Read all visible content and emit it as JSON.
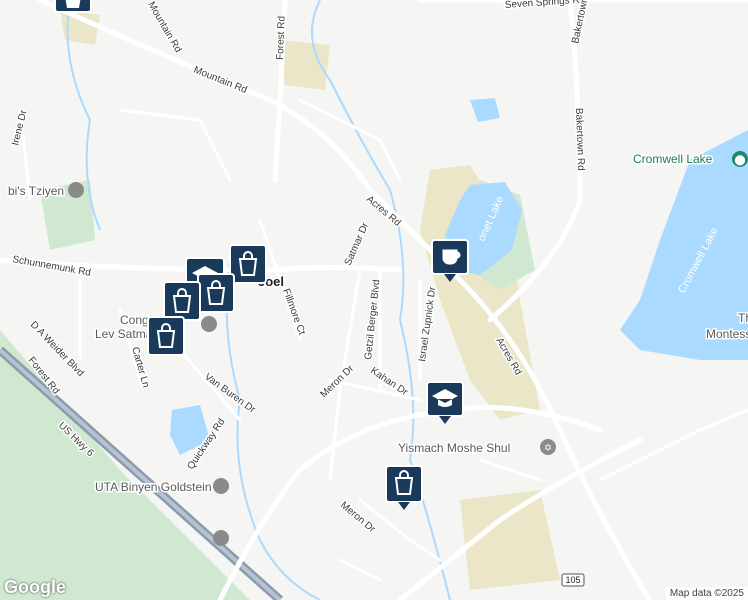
{
  "map": {
    "logo": "Google",
    "attribution": "Map data ©2025",
    "place": "Joel",
    "colors": {
      "background": "#f5f5f3",
      "water": "#aadaff",
      "green": "#c8e6c9",
      "sand": "#ece6c8",
      "highway": "#8a9bb0",
      "road": "#ffffff",
      "marker": "#1a3a5c"
    },
    "roads": [
      {
        "id": "seven-springs-rd",
        "label": "Seven Springs Rd"
      },
      {
        "id": "mountain-rd-top",
        "label": "Mountain Rd"
      },
      {
        "id": "mountain-rd",
        "label": "Mountain Rd"
      },
      {
        "id": "forest-rd-top",
        "label": "Forest Rd"
      },
      {
        "id": "bakertown-rd-top",
        "label": "Bakertown Rd"
      },
      {
        "id": "bakertown-rd",
        "label": "Bakertown Rd"
      },
      {
        "id": "irene-dr",
        "label": "Irene Dr"
      },
      {
        "id": "acres-rd",
        "label": "Acres Rd"
      },
      {
        "id": "acres-rd-south",
        "label": "Acres Rd"
      },
      {
        "id": "satmar-dr",
        "label": "Satmar Dr"
      },
      {
        "id": "schunnemunk-rd",
        "label": "Schunnemunk Rd"
      },
      {
        "id": "fillmore-ct",
        "label": "Fillmore Ct"
      },
      {
        "id": "getzil-berger-blvd",
        "label": "Getzil Berger Blvd"
      },
      {
        "id": "israel-zupnick-dr",
        "label": "Israel Zupnick Dr"
      },
      {
        "id": "d-a-weider-blvd",
        "label": "D A Weider Blvd"
      },
      {
        "id": "forest-rd",
        "label": "Forest Rd"
      },
      {
        "id": "carter-ln",
        "label": "Carter Ln"
      },
      {
        "id": "van-buren-dr",
        "label": "Van Buren Dr"
      },
      {
        "id": "meron-dr",
        "label": "Meron Dr"
      },
      {
        "id": "kahan-dr",
        "label": "Kahan Dr"
      },
      {
        "id": "quickway-rd",
        "label": "Quickway Rd"
      },
      {
        "id": "us-hwy-6",
        "label": "US Hwy 6"
      },
      {
        "id": "meron-dr-south",
        "label": "Meron Dr"
      },
      {
        "id": "route-105",
        "label": "105"
      }
    ],
    "pois": [
      {
        "id": "cromwell-lake-poi",
        "label": "Cromwell Lake"
      },
      {
        "id": "yismach-moshe-shul",
        "label": "Yismach Moshe Shul"
      },
      {
        "id": "uta-binyen-goldstein",
        "label": "UTA Binyen Goldstein"
      },
      {
        "id": "tziyen",
        "label": "bi's Tziyen"
      },
      {
        "id": "cong-lev-satmar",
        "label": "Cong"
      },
      {
        "id": "lev-satmar",
        "label": "Lev Satmar Shul"
      },
      {
        "id": "montessori",
        "label": "Montessori"
      },
      {
        "id": "montessori-th",
        "label": "Th"
      }
    ],
    "water_labels": [
      {
        "id": "cromwell-lake-water",
        "label": "Cromwell Lake"
      },
      {
        "id": "pond-label",
        "label": "onet Lake"
      }
    ],
    "markers": [
      {
        "id": "marker-cafe",
        "kind": "cafe",
        "icon": "coffee-cup-icon"
      },
      {
        "id": "marker-school-east",
        "kind": "school",
        "icon": "graduation-cap-icon"
      },
      {
        "id": "marker-shopping-south",
        "kind": "shopping",
        "icon": "shopping-bag-icon"
      },
      {
        "id": "marker-shopping-top",
        "kind": "shopping",
        "icon": "shopping-bag-icon"
      },
      {
        "id": "marker-school-west",
        "kind": "school",
        "icon": "graduation-cap-icon"
      },
      {
        "id": "marker-shopping-a",
        "kind": "shopping",
        "icon": "shopping-bag-icon"
      },
      {
        "id": "marker-shopping-b",
        "kind": "shopping",
        "icon": "shopping-bag-icon"
      },
      {
        "id": "marker-shopping-c",
        "kind": "shopping",
        "icon": "shopping-bag-icon"
      },
      {
        "id": "marker-shopping-d",
        "kind": "shopping",
        "icon": "shopping-bag-icon"
      }
    ]
  }
}
